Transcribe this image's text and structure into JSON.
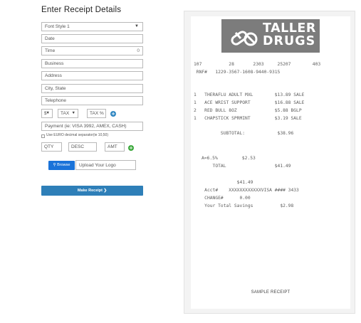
{
  "form": {
    "title": "Enter Receipt Details",
    "font_style": "Font Style 1",
    "date_placeholder": "Date",
    "time_placeholder": "Time",
    "time_suffix": "0",
    "business_placeholder": "Business",
    "address_placeholder": "Address",
    "city_state_placeholder": "City, State",
    "telephone_placeholder": "Telephone",
    "currency": "$",
    "tax_select": "TAX",
    "tax_percent_placeholder": "TAX %",
    "payment_placeholder": "Payment (ie: VISA 3992, AMEX, CASH)",
    "euro_label": "Use EURO decimal separator(ie 10,50)",
    "qty_placeholder": "QTY",
    "desc_placeholder": "DESC",
    "amt_placeholder": "AMT",
    "browse_label": "Browse",
    "upload_placeholder": "Upload Your Logo",
    "make_receipt_label": "Make Receipt"
  },
  "colors": {
    "plus_blue": "#2e86c1",
    "plus_green": "#3aa83a",
    "browse_blue": "#1a73d9",
    "make_button": "#2e7fb8",
    "logo_bg": "#7c7c7c"
  },
  "receipt": {
    "logo_line1": "TALLER",
    "logo_line2": "DRUGS",
    "header1": "107          28       2303     25207        403",
    "header2": " RNF#   1229-3567-1608-9440-9315",
    "items": [
      "1   THERAFLU ADULT MXL        $13.89 SALE",
      "1   ACE WRIST SUPPORT         $16.88 SALE",
      "2   RED BULL 8OZ              $5.88 BGLP",
      "1   CHAPSTICK SPRMINT         $3.19 SALE"
    ],
    "subtotal": "          SUBTOTAL:            $38.96",
    "tax_rate": "A=6.5%         $2.53",
    "total": "       TOTAL                  $41.49",
    "amount": "                $41.49",
    "acct": "    Acct#    XXXXXXXXXXXXVISA #### 3433",
    "change": "    CHANGE#      0.00",
    "savings": "    Your Total Savings          $2.98",
    "footer": "SAMPLE RECEIPT"
  }
}
